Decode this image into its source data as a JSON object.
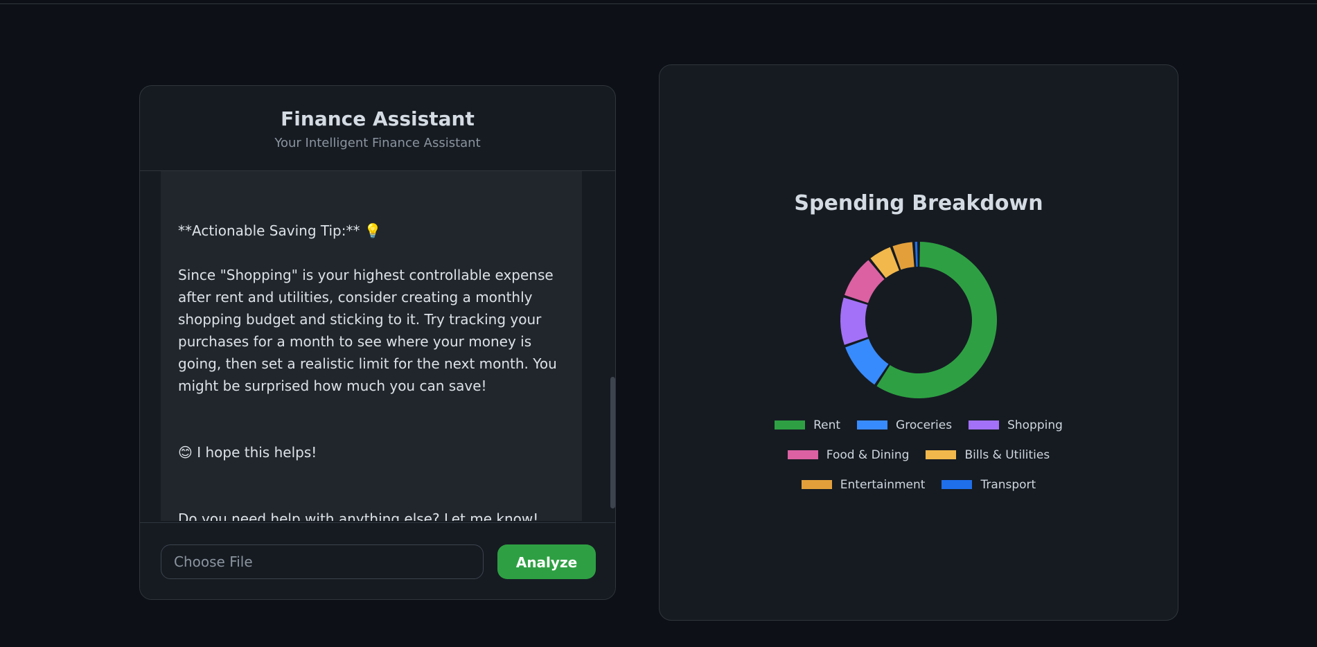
{
  "chat": {
    "title": "Finance Assistant",
    "subtitle": "Your Intelligent Finance Assistant",
    "messages": {
      "tip_heading": "**Actionable Saving Tip:** 💡",
      "tip_text": "Since \"Shopping\" is your highest controllable expense after rent and utilities, consider creating a monthly shopping budget and sticking to it. Try tracking your purchases for a month to see where your money is going, then set a realistic limit for the next month. You might be surprised how much you can save!",
      "hope_text": "😊 I hope this helps!",
      "closing_text": "Do you need help with anything else? Let me know!"
    },
    "file_input_placeholder": "Choose File",
    "analyze_label": "Analyze"
  },
  "chart_data": {
    "type": "pie",
    "title": "Spending Breakdown",
    "categories": [
      "Rent",
      "Groceries",
      "Shopping",
      "Food & Dining",
      "Bills & Utilities",
      "Entertainment",
      "Transport"
    ],
    "values": [
      57.5,
      10,
      10,
      9,
      5,
      4.5,
      1
    ],
    "colors": [
      "#2ea043",
      "#388bfd",
      "#a371f7",
      "#db61a2",
      "#f2b84b",
      "#e3a03a",
      "#1f6feb"
    ],
    "legend_position": "bottom"
  }
}
